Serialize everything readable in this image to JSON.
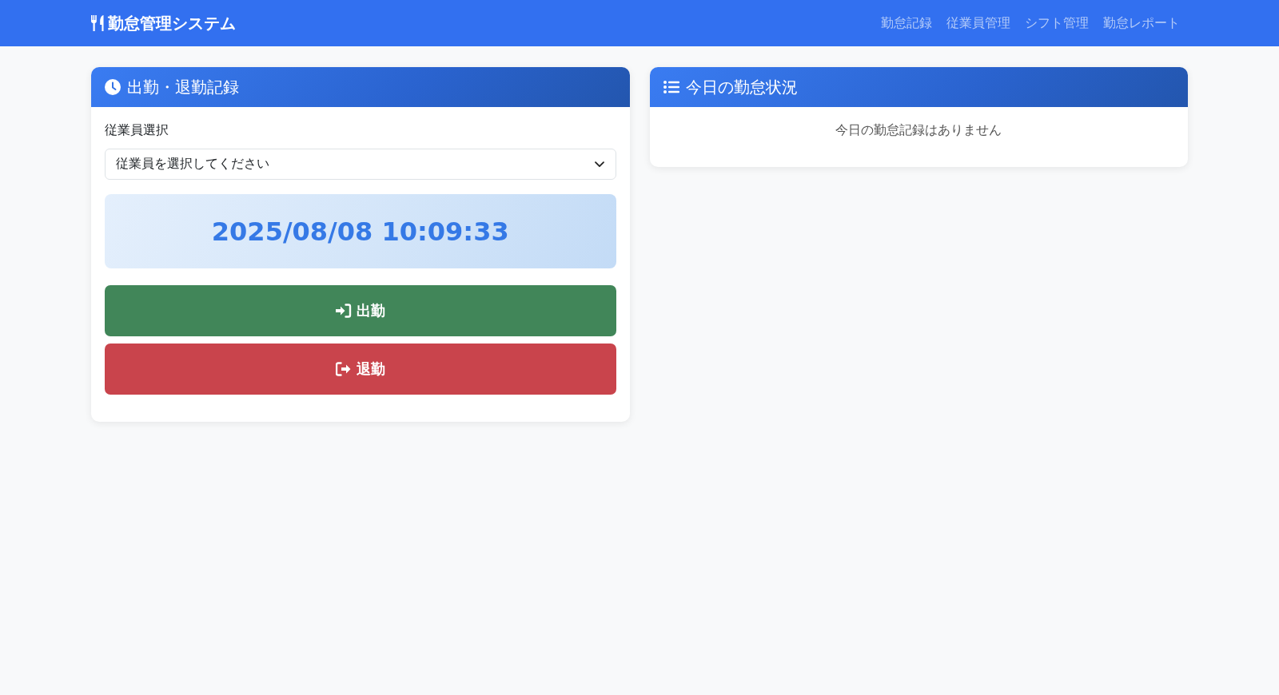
{
  "navbar": {
    "brand": "勤怠管理システム",
    "links": [
      {
        "label": "勤怠記録"
      },
      {
        "label": "従業員管理"
      },
      {
        "label": "シフト管理"
      },
      {
        "label": "勤怠レポート"
      }
    ]
  },
  "attendance_card": {
    "title": "出勤・退勤記録",
    "employee_label": "従業員選択",
    "employee_select": {
      "placeholder": "従業員を選択してください"
    },
    "clock": "2025/08/08 10:09:33",
    "buttons": [
      {
        "kind": "clock_in",
        "label": "出勤"
      },
      {
        "kind": "clock_out",
        "label": "退勤"
      }
    ]
  },
  "status_card": {
    "title": "今日の勤怠状況",
    "empty_message": "今日の勤怠記録はありません"
  }
}
